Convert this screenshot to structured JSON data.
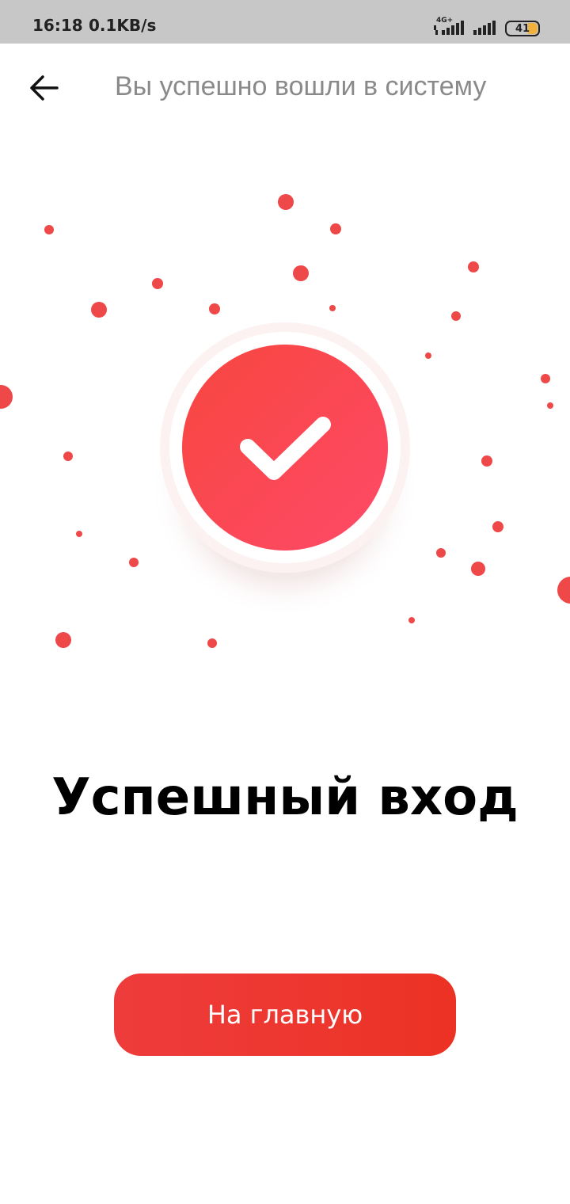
{
  "status_bar": {
    "time": "16:18",
    "net_speed": "0.1KB/s",
    "network_type": "4G+",
    "battery_level": "41"
  },
  "header": {
    "back_icon": "arrow-left-icon",
    "title": "Вы успешно вошли в систему"
  },
  "success": {
    "icon": "checkmark-icon",
    "headline": "Успешный вход"
  },
  "actions": {
    "home_button_label": "На главную"
  },
  "colors": {
    "accent_red": "#ee3c3c",
    "accent_pink": "#ff4a5e",
    "title_gray": "#8a8a8a"
  }
}
